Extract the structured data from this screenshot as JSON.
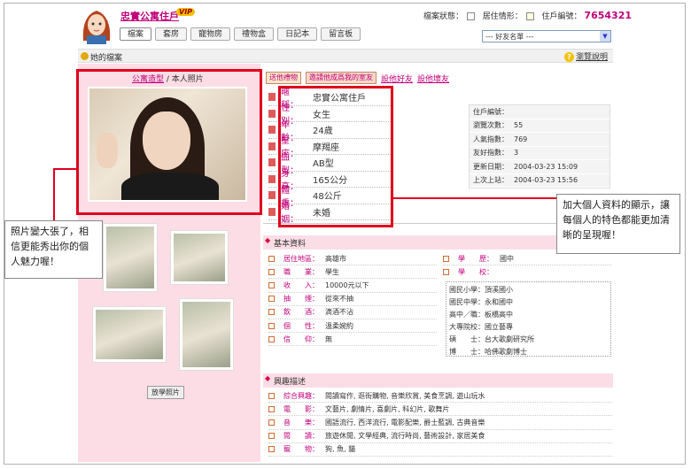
{
  "header": {
    "site_name": "忠實公寓住戶",
    "vip_badge": "VIP",
    "status_label": "檔案狀態：",
    "residence_label": "居住情形：",
    "resident_id_label": "住戶編號：",
    "resident_id": "7654321"
  },
  "tabs": [
    "檔案",
    "套房",
    "寵物房",
    "禮物盒",
    "日記本",
    "留言板"
  ],
  "friends_select": "--- 好友名單 ---",
  "bar": {
    "title": "她的檔案",
    "help": "瀏覽說明"
  },
  "photo": {
    "link_label": "公寓造型",
    "sep": " / ",
    "label": "本人照片",
    "more_button": "放學照片"
  },
  "actions": {
    "gift": "送他禮物",
    "invite": "邀請他成爲我的室友",
    "good": "設他好友",
    "bad": "設他壞友"
  },
  "profile": [
    {
      "label": "暱　稱：",
      "value": "忠實公寓住戶"
    },
    {
      "label": "性　別：",
      "value": "女生"
    },
    {
      "label": "年　齡：",
      "value": "24歲"
    },
    {
      "label": "星　座：",
      "value": "摩羯座"
    },
    {
      "label": "血　型：",
      "value": "AB型"
    },
    {
      "label": "身　高：",
      "value": "165公分"
    },
    {
      "label": "體　重：",
      "value": "48公斤"
    },
    {
      "label": "婚　姻：",
      "value": "未婚"
    }
  ],
  "stats": [
    {
      "label": "住戶編號：",
      "value": ""
    },
    {
      "label": "瀏覽次數：",
      "value": "55"
    },
    {
      "label": "人氣指數：",
      "value": "769"
    },
    {
      "label": "友好指數：",
      "value": "3"
    },
    {
      "label": "更新日期：",
      "value": "2004-03-23 15:09"
    },
    {
      "label": "上次上站：",
      "value": "2004-03-23 15:56"
    }
  ],
  "basic": {
    "title": "基本資料",
    "rows": [
      {
        "label": "居住地區：",
        "value": "高雄市"
      },
      {
        "label": "職　　業：",
        "value": "學生"
      },
      {
        "label": "收　　入：",
        "value": "10000元以下"
      },
      {
        "label": "抽　　煙：",
        "value": "從來不抽"
      },
      {
        "label": "飲　　酒：",
        "value": "滴酒不沾"
      },
      {
        "label": "個　　性：",
        "value": "溫柔婉約"
      },
      {
        "label": "信　　仰：",
        "value": "無"
      }
    ],
    "edu_label": "學　　歷：",
    "edu_value": "國中",
    "school_label": "學　　校：",
    "schools": [
      "國民小學：頂溪國小",
      "國民中學：永和國中",
      "高中／職：板橋高中",
      "大專院校：國立藝專",
      "碩　　士：台大歌劇研究所",
      "博　　士：哈佛歌劇博士"
    ]
  },
  "interests": {
    "title": "興趣描述",
    "rows": [
      {
        "label": "綜合興趣：",
        "value": "閱讀寫作, 逛街購物, 音樂欣賞, 美食烹調, 遊山玩水"
      },
      {
        "label": "電　　影：",
        "value": "文藝片, 劇情片, 喜劇片, 科幻片, 歌舞片"
      },
      {
        "label": "音　　樂：",
        "value": "國語流行, 西洋流行, 電影配樂, 爵士藍調, 古典音樂"
      },
      {
        "label": "閱　　讀：",
        "value": "旅遊休閒, 文學經典, 流行時尚, 藝術設計, 家居美食"
      },
      {
        "label": "寵　　物：",
        "value": "狗, 魚, 貓"
      }
    ]
  },
  "callouts": {
    "left": "照片變大張了，相信更能秀出你的個人魅力喔！",
    "right": "加大個人資料的顯示，讓每個人的特色都能更加清晰的呈現喔！"
  },
  "colors": {
    "accent": "#c0007a",
    "pink_bg": "#fcdde6",
    "red_highlight": "#e0001c"
  }
}
